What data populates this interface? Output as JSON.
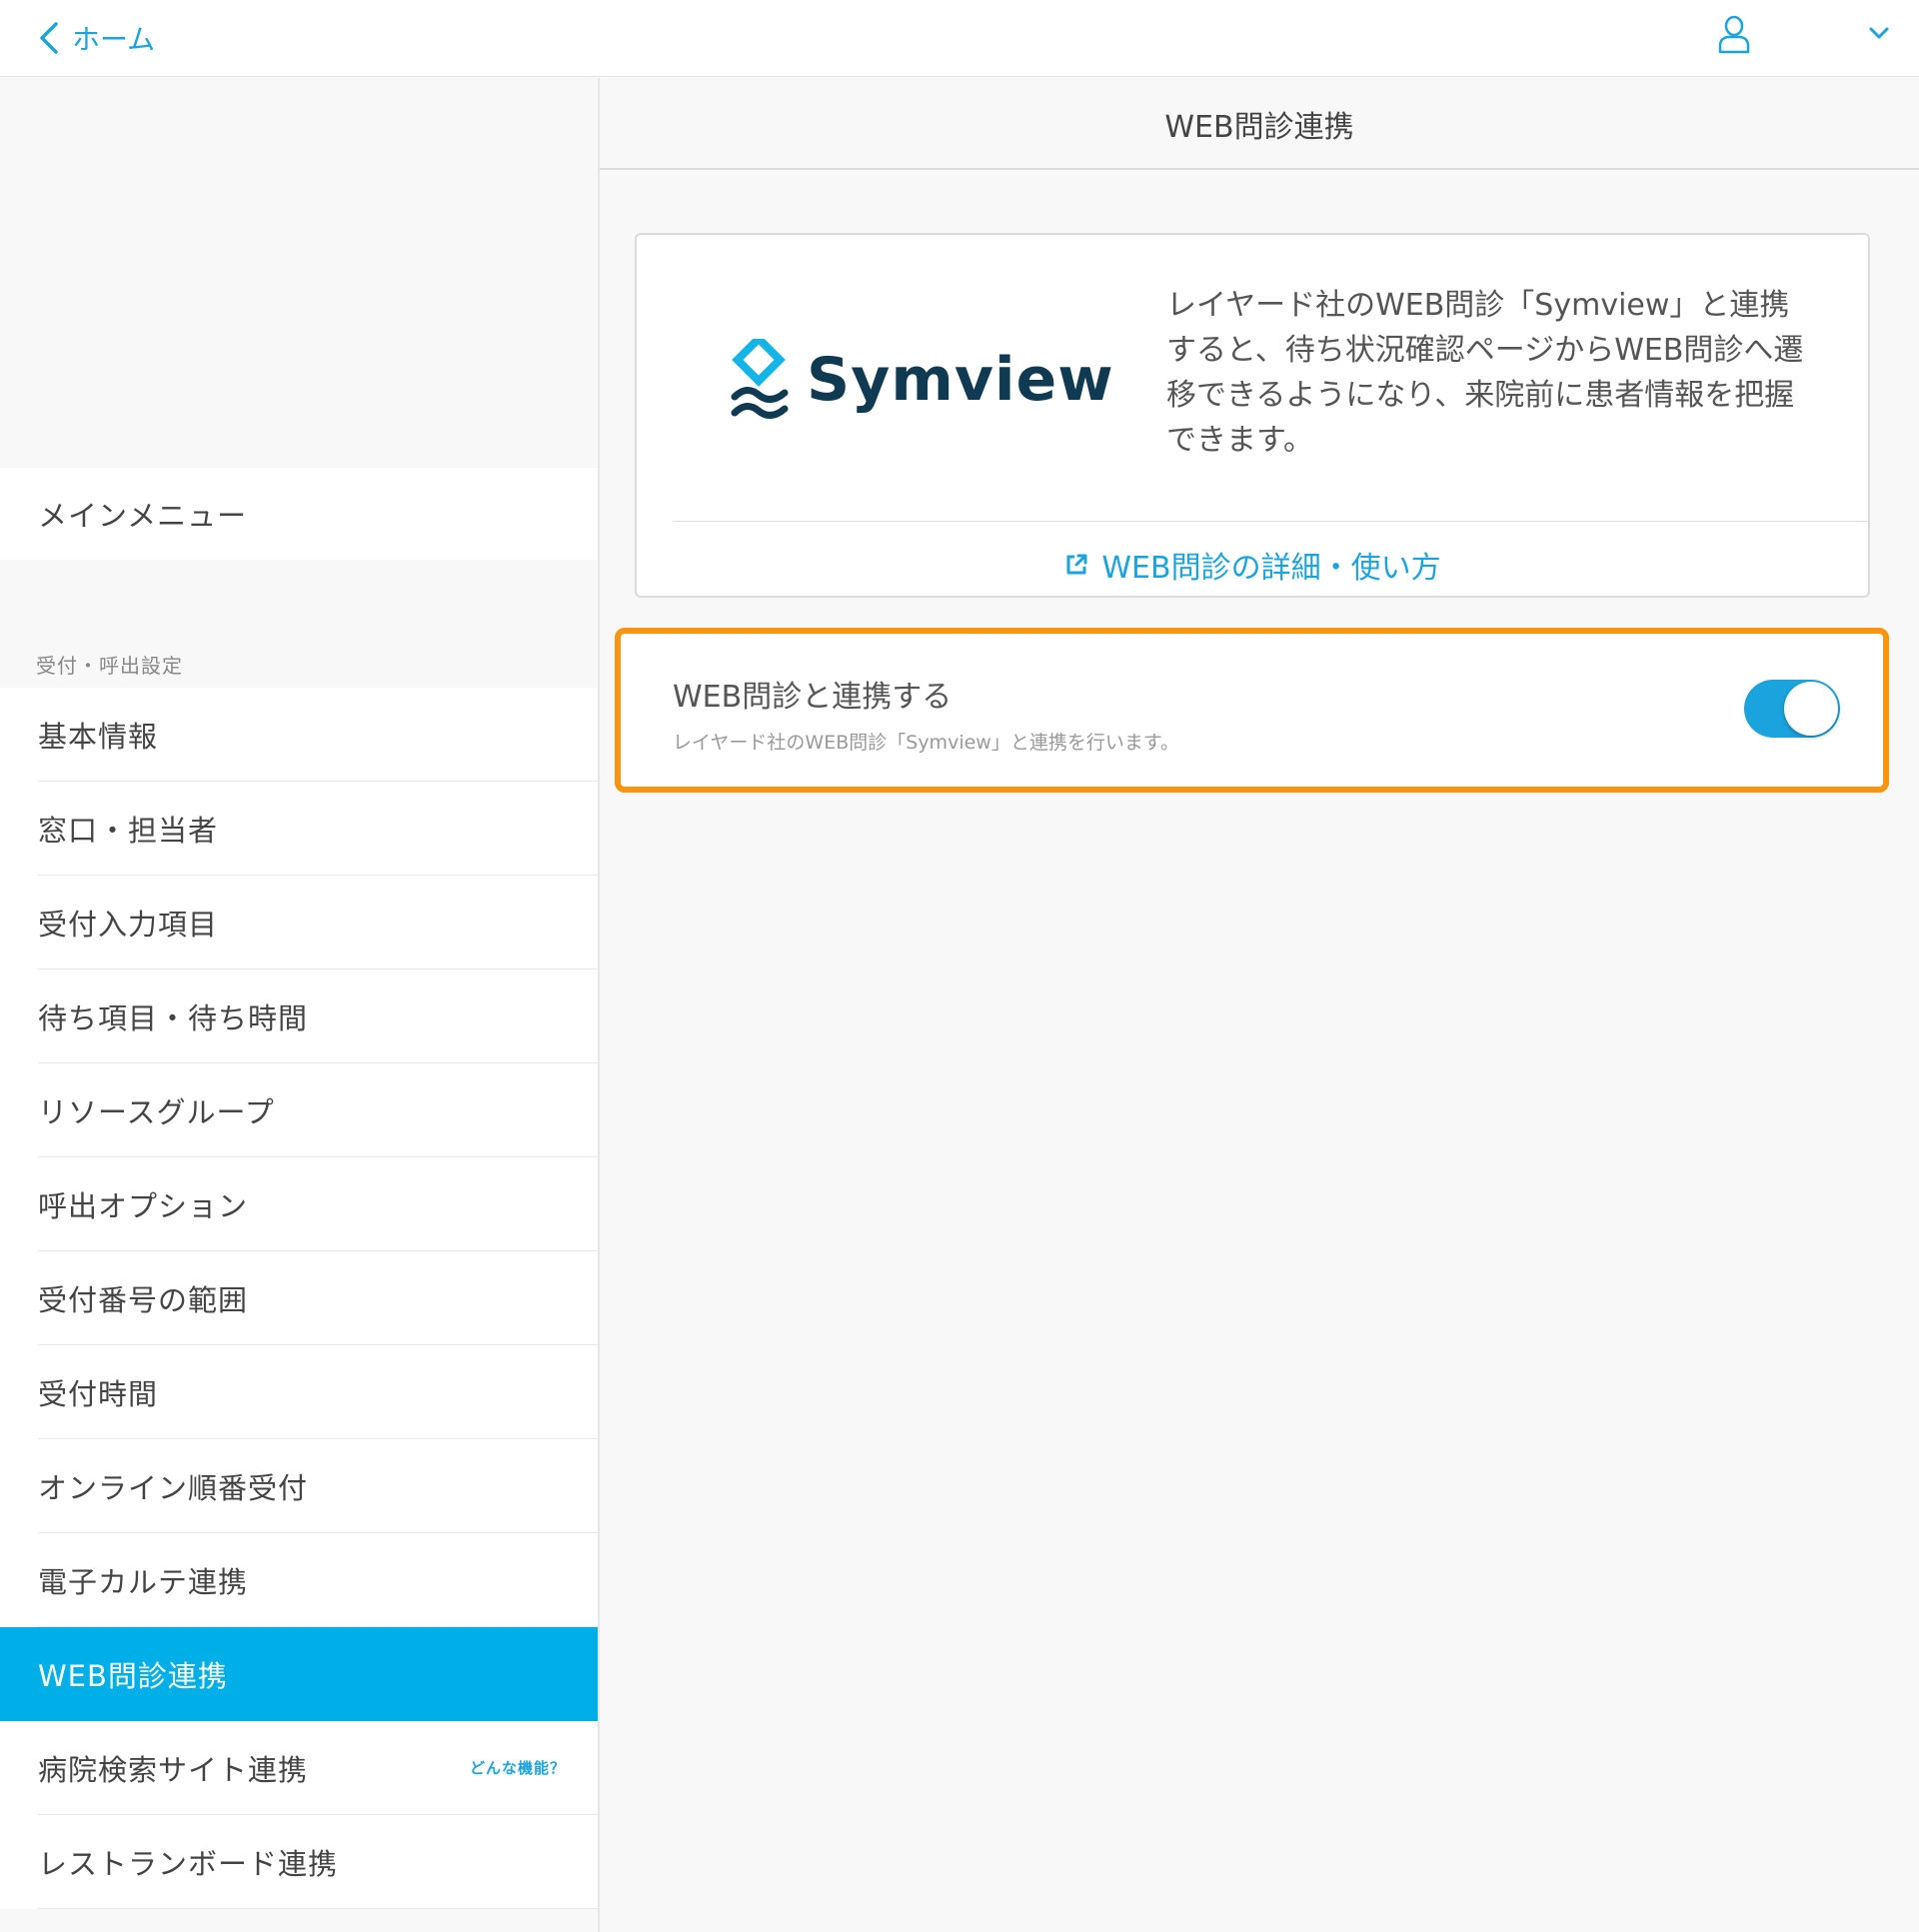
{
  "topbar": {
    "back_label": "ホーム",
    "icons": {
      "back": "chevron-left-icon",
      "user": "user-icon",
      "menu": "chevron-down-icon"
    }
  },
  "sidebar": {
    "main_menu": "メインメニュー",
    "section_header": "受付・呼出設定",
    "items": [
      {
        "label": "基本情報"
      },
      {
        "label": "窓口・担当者"
      },
      {
        "label": "受付入力項目"
      },
      {
        "label": "待ち項目・待ち時間"
      },
      {
        "label": "リソースグループ"
      },
      {
        "label": "呼出オプション"
      },
      {
        "label": "受付番号の範囲"
      },
      {
        "label": "受付時間"
      },
      {
        "label": "オンライン順番受付"
      },
      {
        "label": "電子カルテ連携"
      },
      {
        "label": "WEB問診連携",
        "active": true
      },
      {
        "label": "病院検索サイト連携",
        "help": "どんな機能？"
      },
      {
        "label": "レストランボード連携"
      }
    ]
  },
  "content": {
    "title": "WEB問診連携",
    "card": {
      "logo_text": "Symview",
      "description": "レイヤード社のWEB問診「Symview」と連携すると、待ち状況確認ページからWEB問診へ遷移できるようになり、来院前に患者情報を把握できます。",
      "link_label": "WEB問診の詳細・使い方"
    },
    "toggle": {
      "title": "WEB問診と連携する",
      "subtitle": "レイヤード社のWEB問診「Symview」と連携を行います。",
      "enabled": true
    }
  },
  "colors": {
    "accent": "#1ba3dd",
    "active_bg": "#00aee8",
    "highlight": "#f7950e",
    "logo_dark": "#0f3a52",
    "logo_cyan": "#14b4e6"
  }
}
